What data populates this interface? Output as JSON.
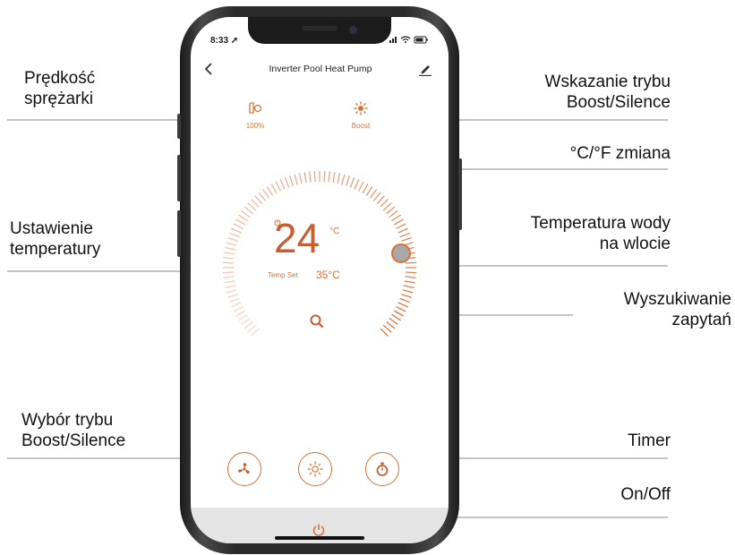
{
  "annotations": {
    "compressor_speed": [
      "Prędkość",
      "sprężarki"
    ],
    "mode_indicator": [
      "Wskazanie trybu",
      "Boost/Silence"
    ],
    "unit_change": "°C/°F zmiana",
    "temp_setting": [
      "Ustawienie",
      "temperatury"
    ],
    "inlet_temp": [
      "Temperatura wody",
      "na wlocie"
    ],
    "query_search": [
      "Wyszukiwanie",
      "zapytań"
    ],
    "mode_select": [
      "Wybór trybu",
      "Boost/Silence"
    ],
    "timer": "Timer",
    "on_off": "On/Off"
  },
  "status_bar": {
    "time": "8:33",
    "icons": "signal-icon wifi-icon battery-icon"
  },
  "app": {
    "title": "Inverter Pool Heat Pump",
    "back_icon": "chevron-left-icon",
    "edit_icon": "pencil-icon",
    "compressor": {
      "icon": "compressor-icon",
      "value": "100%"
    },
    "mode": {
      "icon": "sun-icon",
      "value": "Boost"
    },
    "inlet_temperature": "24",
    "inlet_unit": "°C",
    "temp_set_label": "Temp Set",
    "temp_set_value": "35°C",
    "buttons": [
      "fan-icon",
      "sun-icon",
      "timer-icon"
    ],
    "power_icon": "power-icon"
  },
  "colors": {
    "accent": "#d9733a",
    "accent_dark": "#c85e32",
    "bar_gray": "#e5e5e5"
  }
}
